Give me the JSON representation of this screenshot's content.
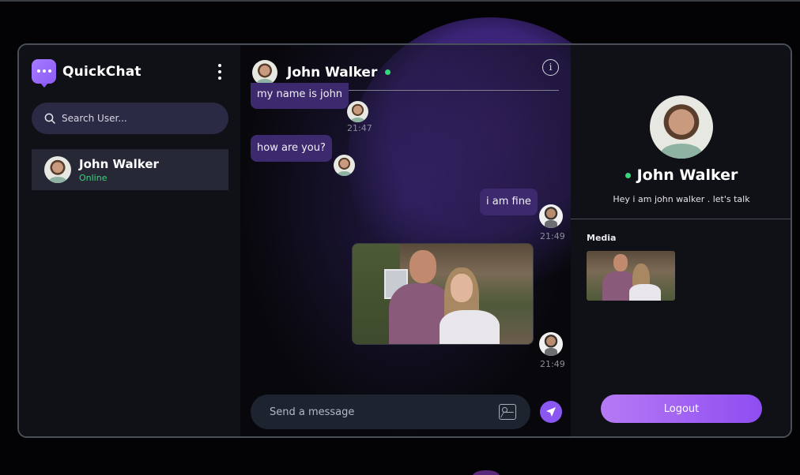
{
  "app": {
    "brand_name": "QuickChat",
    "accent_color": "#8d5cf6",
    "online_color": "#36d67a"
  },
  "sidebar": {
    "search_placeholder": "Search User...",
    "users": [
      {
        "name": "John Walker",
        "status": "Online"
      }
    ]
  },
  "chat": {
    "header_name": "John Walker",
    "messages": [
      {
        "text": "my name is john",
        "time": "21:47",
        "side": "left"
      },
      {
        "text": "how are you?",
        "time": "",
        "side": "left"
      },
      {
        "text": "i am fine",
        "time": "21:49",
        "side": "right"
      },
      {
        "type": "image",
        "time": "21:49",
        "side": "right"
      }
    ],
    "composer_placeholder": "Send a message"
  },
  "profile": {
    "name": "John Walker",
    "bio": "Hey i am john walker . let's talk",
    "media_label": "Media",
    "logout_label": "Logout"
  }
}
